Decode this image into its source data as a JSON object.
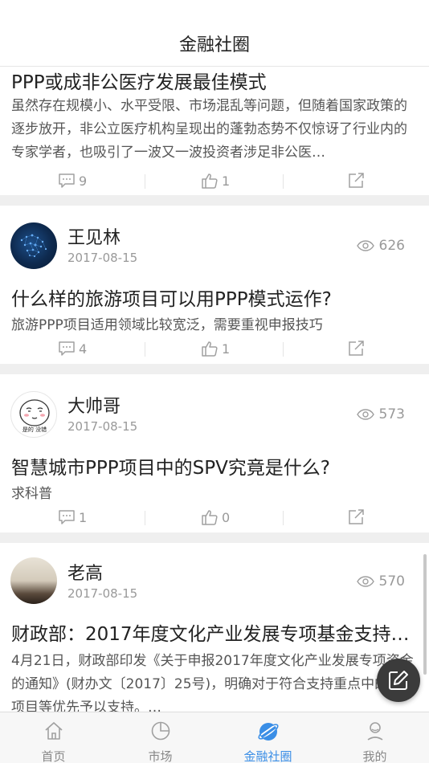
{
  "header": {
    "title": "金融社圈"
  },
  "posts": [
    {
      "title": "PPP或成非公医疗发展最佳模式",
      "excerpt": "虽然存在规模小、水平受限、市场混乱等问题，但随着国家政策的逐步放开，非公立医疗机构呈现出的蓬勃态势不仅惊讶了行业内的专家学者，也吸引了一波又一波投资者涉足非公医…",
      "comments": "9",
      "likes": "1"
    },
    {
      "author": "王见林",
      "date": "2017-08-15",
      "views": "626",
      "title": "什么样的旅游项目可以用PPP模式运作?",
      "excerpt": "旅游PPP项目适用领域比较宽泛，需要重视申报技巧",
      "comments": "4",
      "likes": "1"
    },
    {
      "author": "大帅哥",
      "date": "2017-08-15",
      "views": "573",
      "avatar_text": "是的 没错",
      "title": "智慧城市PPP项目中的SPV究竟是什么?",
      "excerpt": "求科普",
      "comments": "1",
      "likes": "0"
    },
    {
      "author": "老高",
      "date": "2017-08-15",
      "views": "570",
      "title": "财政部：2017年度文化产业发展专项基金支持…",
      "excerpt": "4月21日，财政部印发《关于申报2017年度文化产业发展专项资金的通知》(财办文〔2017〕25号)，明确对于符合支持重点中的PPP项目等优先予以支持。…"
    }
  ],
  "tabs": [
    {
      "label": "首页",
      "icon": "home-icon"
    },
    {
      "label": "市场",
      "icon": "pie-chart-icon"
    },
    {
      "label": "金融社圈",
      "icon": "planet-icon",
      "active": true
    },
    {
      "label": "我的",
      "icon": "user-icon"
    }
  ],
  "colors": {
    "accent": "#3a8ee6",
    "icon_gray": "#a0a0a0",
    "fab": "#3b3b3b"
  }
}
